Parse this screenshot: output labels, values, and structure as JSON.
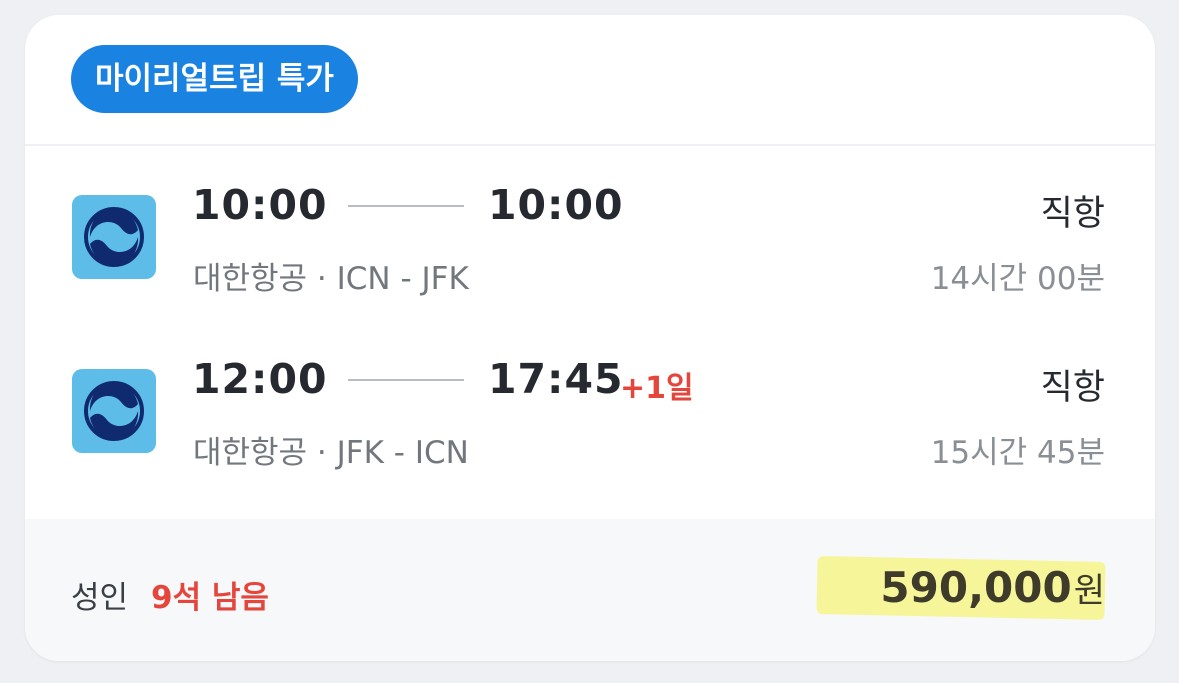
{
  "badge": {
    "label": "마이리얼트립 특가"
  },
  "flights": [
    {
      "airline_icon": "korean-air-logo-icon",
      "departure_time": "10:00",
      "arrival_time": "10:00",
      "day_offset": "",
      "route": "대한항공 · ICN - JFK",
      "stops": "직항",
      "duration": "14시간 00분"
    },
    {
      "airline_icon": "korean-air-logo-icon",
      "departure_time": "12:00",
      "arrival_time": "17:45",
      "day_offset": "+1일",
      "route": "대한항공 · JFK - ICN",
      "stops": "직항",
      "duration": "15시간 45분"
    }
  ],
  "footer": {
    "passenger_label": "성인",
    "seats_left": "9석 남음",
    "price_amount": "590,000",
    "price_unit": "원"
  },
  "colors": {
    "badge_bg": "#1a82e0",
    "accent_red": "#e5453a",
    "logo_bg": "#5ebce9",
    "highlight": "#f6f59a"
  }
}
